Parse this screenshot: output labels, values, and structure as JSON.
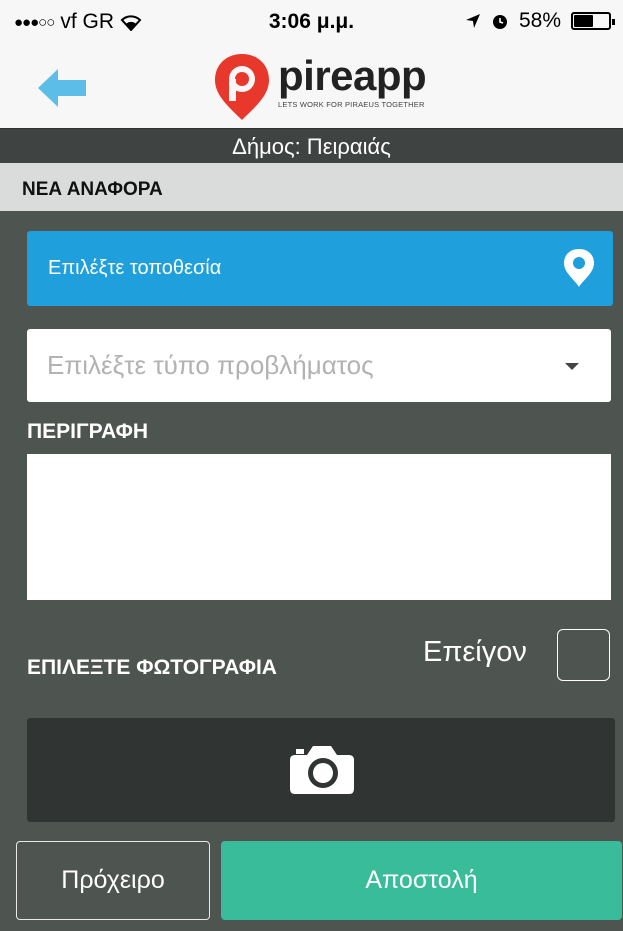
{
  "status_bar": {
    "signal_dots": "●●●○○",
    "carrier": "vf GR",
    "time": "3:06 μ.μ.",
    "battery_text": "58%",
    "battery_level": 0.58
  },
  "header": {
    "logo_name": "pireapp",
    "logo_tagline": "LETS WORK FOR PIRAEUS TOGETHER"
  },
  "municipality": "Δήμος: Πειραιάς",
  "section_title": "ΝΕΑ ΑΝΑΦΟΡΑ",
  "form": {
    "location_label": "Επιλέξτε τοποθεσία",
    "type_placeholder": "Επιλέξτε τύπο προβλήματος",
    "description_label": "ΠΕΡΙΓΡΑΦΗ",
    "description_value": "",
    "urgent_label": "Επείγον",
    "urgent_checked": false,
    "photo_label": "ΕΠΙΛΕΞΤΕ ΦΩΤΟΓΡΑΦΙΑ"
  },
  "actions": {
    "draft_label": "Πρόχειρο",
    "send_label": "Αποστολή"
  },
  "colors": {
    "location_blue": "#1fa0dd",
    "send_green": "#39bc9a",
    "background": "#4e5450",
    "logo_red": "#e8372b",
    "back_arrow": "#5bbde8"
  }
}
